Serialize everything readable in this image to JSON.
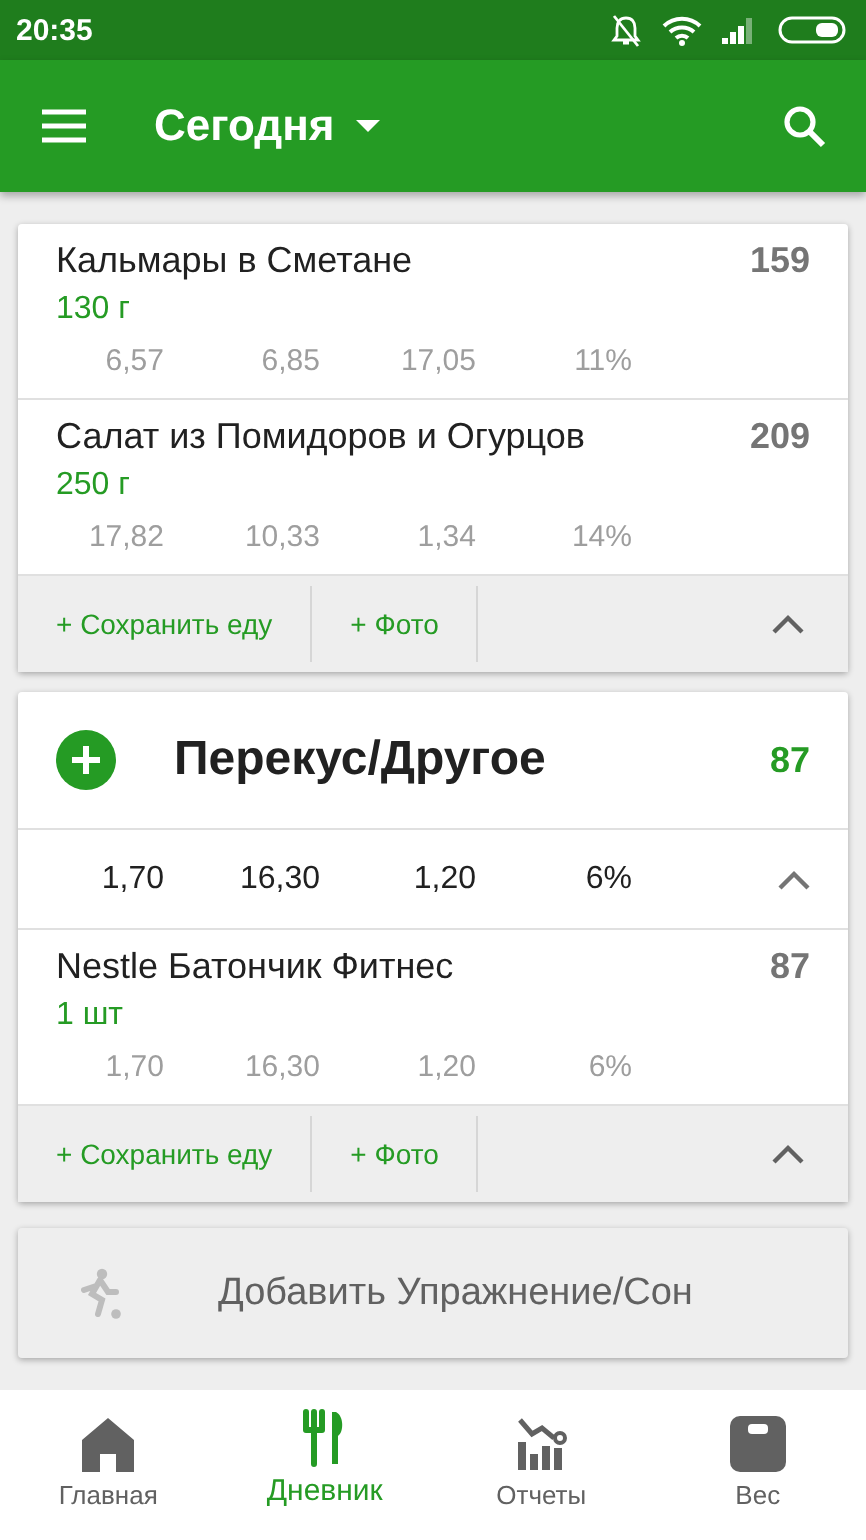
{
  "status_bar": {
    "time": "20:35"
  },
  "app_bar": {
    "title": "Сегодня"
  },
  "meals": [
    {
      "items": [
        {
          "name": "Кальмары в Сметане",
          "amount": "130  г",
          "calories": "159",
          "nutrients": [
            "6,57",
            "6,85",
            "17,05",
            "11%"
          ]
        },
        {
          "name": "Салат из Помидоров и Огурцов",
          "amount": "250  г",
          "calories": "209",
          "nutrients": [
            "17,82",
            "10,33",
            "1,34",
            "14%"
          ]
        }
      ],
      "actions": [
        "+ Сохранить еду",
        "+ Фото"
      ]
    },
    {
      "title": "Перекус/Другое",
      "calories": "87",
      "totals": [
        "1,70",
        "16,30",
        "1,20",
        "6%"
      ],
      "items": [
        {
          "name": "Nestle Батончик Фитнес",
          "amount": "1 шт",
          "calories": "87",
          "nutrients": [
            "1,70",
            "16,30",
            "1,20",
            "6%"
          ]
        }
      ],
      "actions": [
        "+ Сохранить еду",
        "+ Фото"
      ]
    }
  ],
  "exercise_button": {
    "label": "Добавить Упражнение/Сон"
  },
  "bottom_nav": [
    {
      "kind": "home",
      "label": "Главная",
      "selected": false
    },
    {
      "kind": "diary",
      "label": "Дневник",
      "selected": true
    },
    {
      "kind": "reports",
      "label": "Отчеты",
      "selected": false
    },
    {
      "kind": "weight",
      "label": "Вес",
      "selected": false
    }
  ]
}
